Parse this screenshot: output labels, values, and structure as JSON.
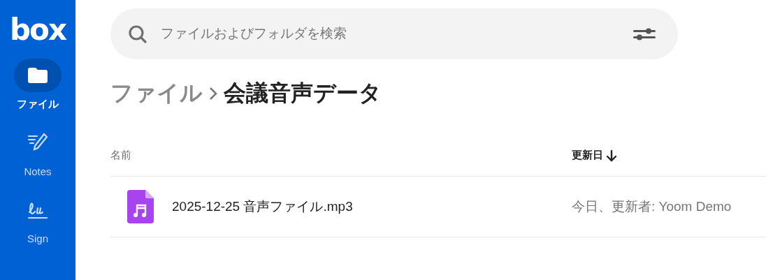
{
  "sidebar": {
    "logo": "box",
    "items": [
      {
        "label": "ファイル",
        "kind": "files",
        "selected": true
      },
      {
        "label": "Notes",
        "kind": "notes",
        "selected": false
      },
      {
        "label": "Sign",
        "kind": "sign",
        "selected": false
      }
    ]
  },
  "search": {
    "placeholder": "ファイルおよびフォルダを検索"
  },
  "breadcrumb": [
    {
      "label": "ファイル",
      "current": false
    },
    {
      "label": "会議音声データ",
      "current": true
    }
  ],
  "table": {
    "columns": [
      {
        "label": "名前",
        "sorted": false
      },
      {
        "label": "更新日",
        "sorted": true
      }
    ],
    "rows": [
      {
        "name": "2025-12-25 音声ファイル.mp3",
        "kind": "audio",
        "modified": "今日、更新者: Yoom Demo"
      }
    ]
  }
}
